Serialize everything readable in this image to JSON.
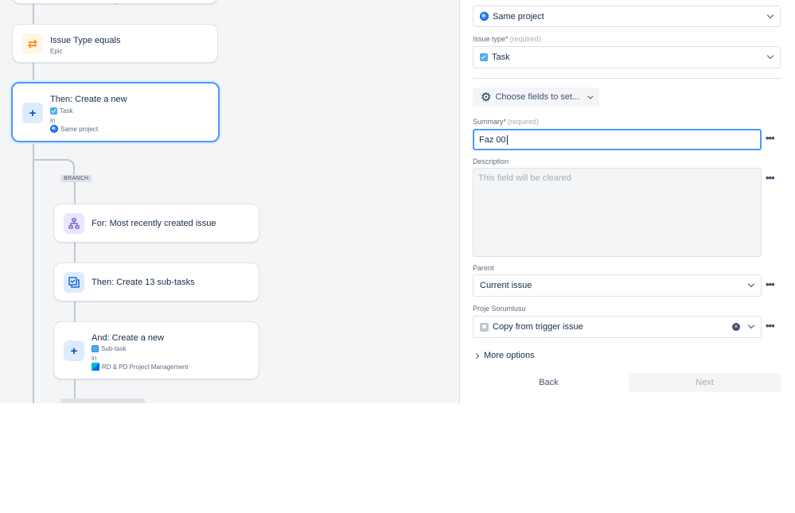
{
  "canvas": {
    "cards": [
      {
        "title": "Issue Type equals",
        "sub": "Epic",
        "icon": "shuffle-icon"
      },
      {
        "title": "Then: Create a new",
        "line1": "Task",
        "in": "in",
        "line2": "Same project",
        "icon": "plus-icon"
      },
      {
        "title": "For: Most recently created issue",
        "icon": "hierarchy-icon"
      },
      {
        "title": "Then: Create 13 sub-tasks",
        "icon": "subtasks-icon"
      },
      {
        "title": "And: Create a new",
        "line1": "Sub-task",
        "in": "in",
        "line2": "RD & PD Project Management",
        "icon": "plus-icon"
      }
    ],
    "branch_label": "BRANCH"
  },
  "panel": {
    "project_select": "Same project",
    "issue_type": {
      "label": "Issue type",
      "required_mark": "*",
      "required_hint": "(required)",
      "value": "Task"
    },
    "choose_fields_label": "Choose fields to set...",
    "summary": {
      "label": "Summary",
      "required_mark": "*",
      "required_hint": "(required)",
      "value": "Faz 00"
    },
    "description": {
      "label": "Description",
      "placeholder": "This field will be cleared"
    },
    "parent": {
      "label": "Parent",
      "value": "Current issue"
    },
    "proje_sorumlusu": {
      "label": "Proje Sorumlusu",
      "value": "Copy from trigger issue"
    },
    "more_options": "More options",
    "back_label": "Back",
    "next_label": "Next"
  },
  "colors": {
    "accent": "#4c9aff",
    "required": "#de350b",
    "task": "#4bade8"
  }
}
